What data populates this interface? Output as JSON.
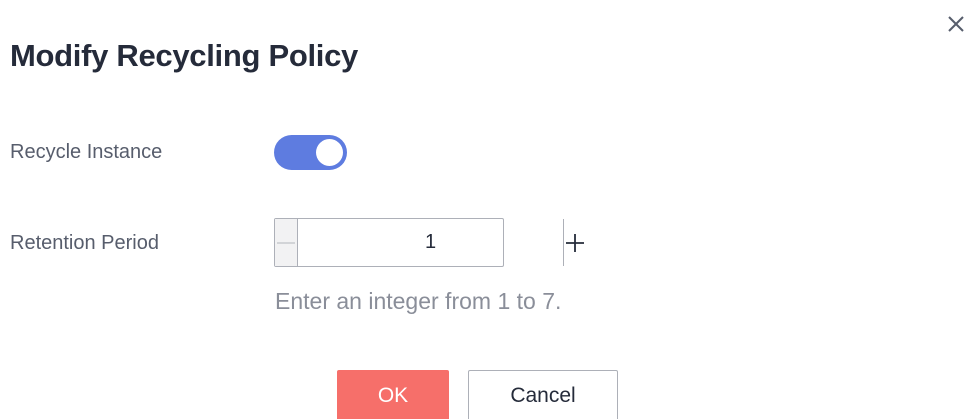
{
  "dialog": {
    "title": "Modify Recycling Policy",
    "close_icon": "close-icon"
  },
  "recycle_instance": {
    "label": "Recycle Instance",
    "enabled": true,
    "color_on": "#5e7ce0"
  },
  "retention_period": {
    "label": "Retention Period",
    "value": "1",
    "decrement_icon": "minus-icon",
    "increment_icon": "plus-icon",
    "hint": "Enter an integer from 1 to 7."
  },
  "footer": {
    "ok_label": "OK",
    "cancel_label": "Cancel",
    "ok_color": "#f66f6a"
  }
}
